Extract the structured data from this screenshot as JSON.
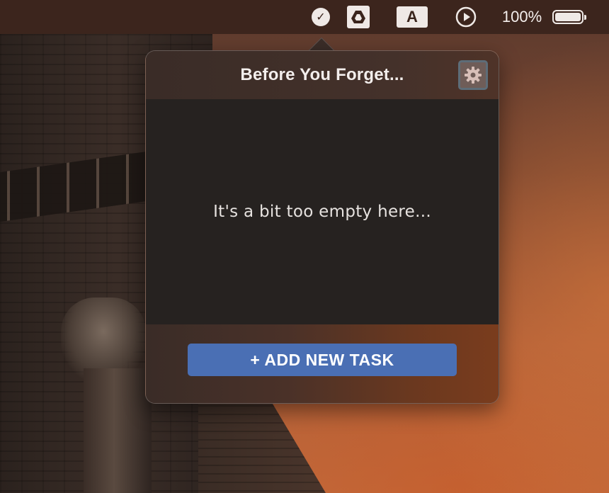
{
  "menubar": {
    "status_icons": [
      "check-circle-icon",
      "google-drive-icon",
      "input-source-icon",
      "play-circle-icon"
    ],
    "input_source_letter": "A",
    "check_glyph": "✓",
    "battery_percent": "100%",
    "battery_level": 1.0
  },
  "popover": {
    "title": "Before You Forget...",
    "settings_icon": "gear-icon",
    "empty_message": "It's a bit too empty here...",
    "add_task_label": "+ ADD NEW TASK",
    "accent_color": "#4a6fb4"
  }
}
